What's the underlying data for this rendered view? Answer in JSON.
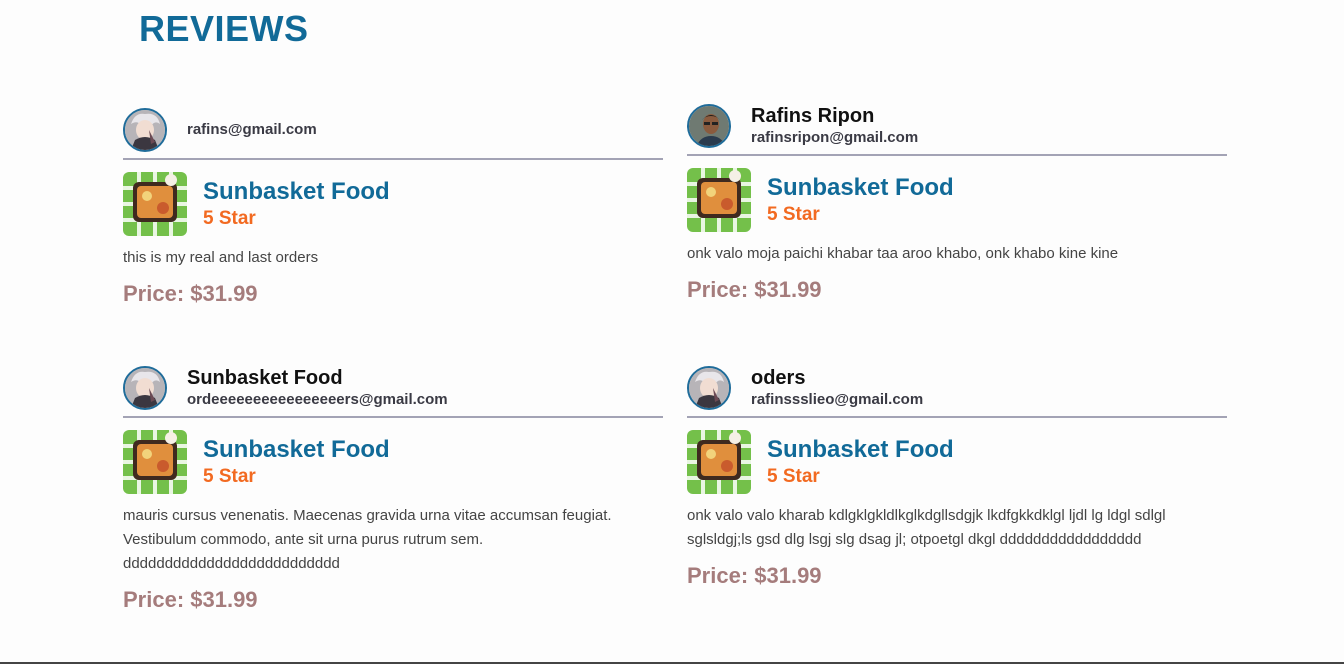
{
  "page": {
    "title": "REVIEWS"
  },
  "reviews": [
    {
      "name": "",
      "email": "rafins@gmail.com",
      "product": "Sunbasket Food",
      "rating": "5 Star",
      "text": "this is my real and last orders",
      "price_label": "Price: $31.99",
      "avatar": "anime-avatar"
    },
    {
      "name": "Rafins Ripon",
      "email": "rafinsripon@gmail.com",
      "product": "Sunbasket Food",
      "rating": "5 Star",
      "text": "onk valo moja paichi khabar taa aroo khabo, onk khabo kine kine",
      "price_label": "Price: $31.99",
      "avatar": "photo-avatar"
    },
    {
      "name": "Sunbasket Food",
      "email": "ordeeeeeeeeeeeeeeeers@gmail.com",
      "product": "Sunbasket Food",
      "rating": "5 Star",
      "text": "mauris cursus venenatis. Maecenas gravida urna vitae accumsan feugiat. Vestibulum commodo, ante sit urna purus rutrum sem. dddddddddddddddddddddddddd",
      "price_label": "Price: $31.99",
      "avatar": "anime-avatar"
    },
    {
      "name": "oders",
      "email": "rafinssslieo@gmail.com",
      "product": "Sunbasket Food",
      "rating": "5 Star",
      "text": "onk valo valo kharab kdlgklgkldlkglkdgllsdgjk lkdfgkkdklgl ljdl lg ldgl sdlgl sglsldgj;ls gsd dlg lsgj slg dsag jl; otpoetgl dkgl ddddddddddddddddd",
      "price_label": "Price: $31.99",
      "avatar": "anime-avatar"
    }
  ]
}
